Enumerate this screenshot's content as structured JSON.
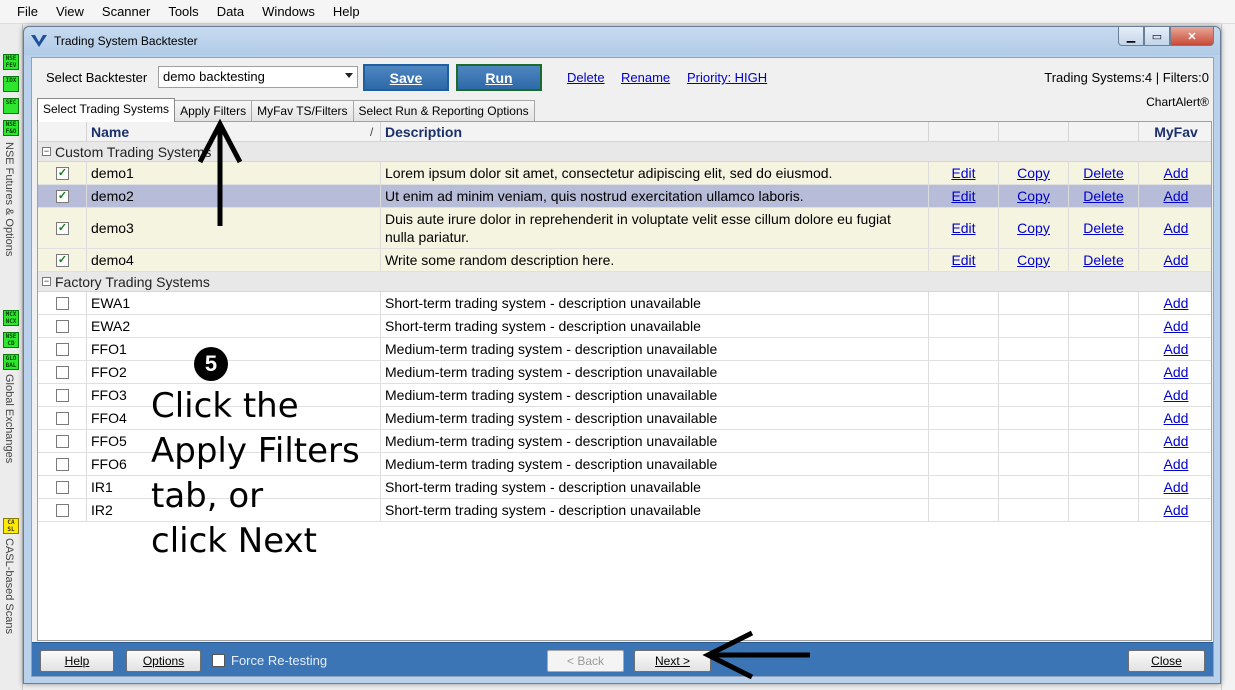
{
  "menu": [
    "File",
    "View",
    "Scanner",
    "Tools",
    "Data",
    "Windows",
    "Help"
  ],
  "sidebar": {
    "labels": [
      "NSE Futures & Options",
      "Global Exchanges",
      "CASL-based Scans"
    ],
    "icons": [
      {
        "name": "nse-fev-icon",
        "text": "NSE FEV"
      },
      {
        "name": "idx-icon",
        "text": "IDX"
      },
      {
        "name": "sec-icon",
        "text": "SEC"
      },
      {
        "name": "nse-fo-icon",
        "text": "NSE F&O"
      },
      {
        "name": "mcx-ncx-icon",
        "text": "MCX NCX"
      },
      {
        "name": "nse-cd-icon",
        "text": "NSE CD"
      },
      {
        "name": "global-icon",
        "text": "GLO BAL"
      },
      {
        "name": "casl-icon",
        "text": "CA SL"
      }
    ]
  },
  "window": {
    "title": "Trading System Backtester"
  },
  "controls": {
    "select_label": "Select Backtester",
    "backtester_value": "demo backtesting",
    "save": "Save",
    "run": "Run",
    "delete": "Delete",
    "rename": "Rename",
    "priority": "Priority: HIGH",
    "status": "Trading Systems:4 | Filters:0",
    "brand": "ChartAlert®"
  },
  "tabs": [
    "Select Trading Systems",
    "Apply Filters",
    "MyFav TS/Filters",
    "Select Run & Reporting Options"
  ],
  "grid": {
    "headers": {
      "name": "Name",
      "description": "Description",
      "myfav": "MyFav"
    },
    "groups": {
      "custom": "Custom Trading Systems",
      "factory": "Factory Trading Systems"
    },
    "custom_rows": [
      {
        "name": "demo1",
        "description": "Lorem ipsum dolor sit amet, consectetur adipiscing elit, sed do eiusmod.",
        "checked": true
      },
      {
        "name": "demo2",
        "description": "Ut enim ad minim veniam, quis nostrud exercitation ullamco laboris.",
        "checked": true,
        "selected": true
      },
      {
        "name": "demo3",
        "description": "Duis aute irure dolor in reprehenderit in voluptate velit esse cillum dolore eu fugiat nulla pariatur.",
        "checked": true
      },
      {
        "name": "demo4",
        "description": "Write some random description here.",
        "checked": true
      }
    ],
    "factory_rows": [
      {
        "name": "EWA1",
        "description": "Short-term trading system - description unavailable"
      },
      {
        "name": "EWA2",
        "description": "Short-term trading system - description unavailable"
      },
      {
        "name": "FFO1",
        "description": "Medium-term trading system - description unavailable"
      },
      {
        "name": "FFO2",
        "description": "Medium-term trading system - description unavailable"
      },
      {
        "name": "FFO3",
        "description": "Medium-term trading system - description unavailable"
      },
      {
        "name": "FFO4",
        "description": "Medium-term trading system - description unavailable"
      },
      {
        "name": "FFO5",
        "description": "Medium-term trading system - description unavailable"
      },
      {
        "name": "FFO6",
        "description": "Medium-term trading system - description unavailable"
      },
      {
        "name": "IR1",
        "description": "Short-term trading system - description unavailable"
      },
      {
        "name": "IR2",
        "description": "Short-term trading system - description unavailable"
      }
    ],
    "actions": {
      "edit": "Edit",
      "copy": "Copy",
      "delete": "Delete",
      "add": "Add"
    }
  },
  "bottom": {
    "help": "Help",
    "options": "Options",
    "force": "Force Re-testing",
    "back": "< Back",
    "next": "Next >",
    "close": "Close"
  },
  "annotation": {
    "step": "❺",
    "lines": [
      "Click the",
      "Apply Filters",
      "tab, or",
      "click Next"
    ]
  },
  "colors": {
    "accent": "#3c75b6",
    "link": "#0000cc",
    "custom_row": "#f5f4e1",
    "selected_row": "#b7bcd8"
  }
}
